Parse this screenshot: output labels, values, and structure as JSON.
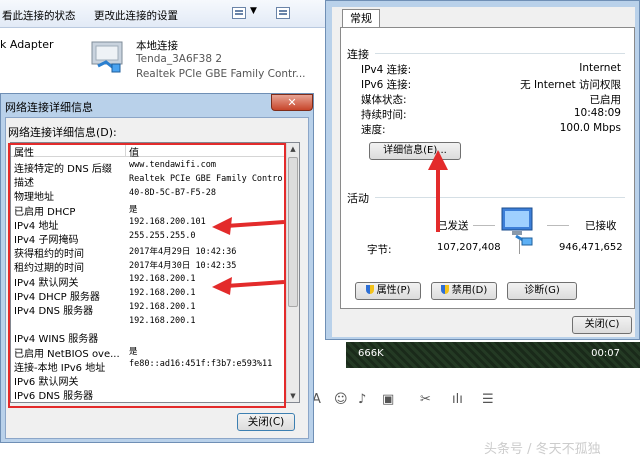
{
  "explorer": {
    "toolbar_view_status": "看此连接的状态",
    "toolbar_change_settings": "更改此连接的设置",
    "adapter_left_label": "k Adapter",
    "adapter_name": "本地连接",
    "adapter_network": "Tenda_3A6F38  2",
    "adapter_device": "Realtek PCIe GBE Family Contr..."
  },
  "details_dialog": {
    "title": "网络连接详细信息",
    "caption": "网络连接详细信息(D):",
    "header_property": "属性",
    "header_value": "值",
    "rows": [
      {
        "p": "连接特定的 DNS 后缀",
        "v": "www.tendawifi.com"
      },
      {
        "p": "描述",
        "v": "Realtek PCIe GBE Family Contro"
      },
      {
        "p": "物理地址",
        "v": "40-8D-5C-B7-F5-28"
      },
      {
        "p": "已启用 DHCP",
        "v": "是"
      },
      {
        "p": "IPv4 地址",
        "v": "192.168.200.101"
      },
      {
        "p": "IPv4 子网掩码",
        "v": "255.255.255.0"
      },
      {
        "p": "获得租约的时间",
        "v": "2017年4月29日 10:42:36"
      },
      {
        "p": "租约过期的时间",
        "v": "2017年4月30日 10:42:35"
      },
      {
        "p": "IPv4 默认网关",
        "v": "192.168.200.1"
      },
      {
        "p": "IPv4 DHCP 服务器",
        "v": "192.168.200.1"
      },
      {
        "p": "IPv4 DNS 服务器",
        "v": "192.168.200.1"
      },
      {
        "p": "",
        "v": "192.168.200.1"
      },
      {
        "p": "IPv4 WINS 服务器",
        "v": ""
      },
      {
        "p": "已启用 NetBIOS ove...",
        "v": "是"
      },
      {
        "p": "连接-本地 IPv6 地址",
        "v": "fe80::ad16:451f:f3b7:e593%11"
      },
      {
        "p": "IPv6 默认网关",
        "v": ""
      },
      {
        "p": "IPv6 DNS 服务器",
        "v": ""
      }
    ],
    "close_button": "关闭(C)"
  },
  "status_window": {
    "tab": "常规",
    "section_connection": "连接",
    "rows": [
      {
        "label": "IPv4 连接:",
        "value": "Internet"
      },
      {
        "label": "IPv6 连接:",
        "value": "无 Internet 访问权限"
      },
      {
        "label": "媒体状态:",
        "value": "已启用"
      },
      {
        "label": "持续时间:",
        "value": "10:48:09"
      },
      {
        "label": "速度:",
        "value": "100.0 Mbps"
      }
    ],
    "details_button": "详细信息(E)...",
    "section_activity": "活动",
    "sent_label": "已发送",
    "received_label": "已接收",
    "bytes_label": "字节:",
    "bytes_sent": "107,207,408",
    "bytes_received": "946,471,652",
    "properties_button": "属性(P)",
    "disable_button": "禁用(D)",
    "diagnose_button": "诊断(G)",
    "close_button": "关闭(C)"
  },
  "media_bar": {
    "left": "666K",
    "right": "00:07"
  },
  "watermark": "头条号 / 冬天不孤独",
  "colors": {
    "annotation": "#e32b2b",
    "title_bar": "#b9d1ea",
    "accent": "#3c7fb1"
  }
}
